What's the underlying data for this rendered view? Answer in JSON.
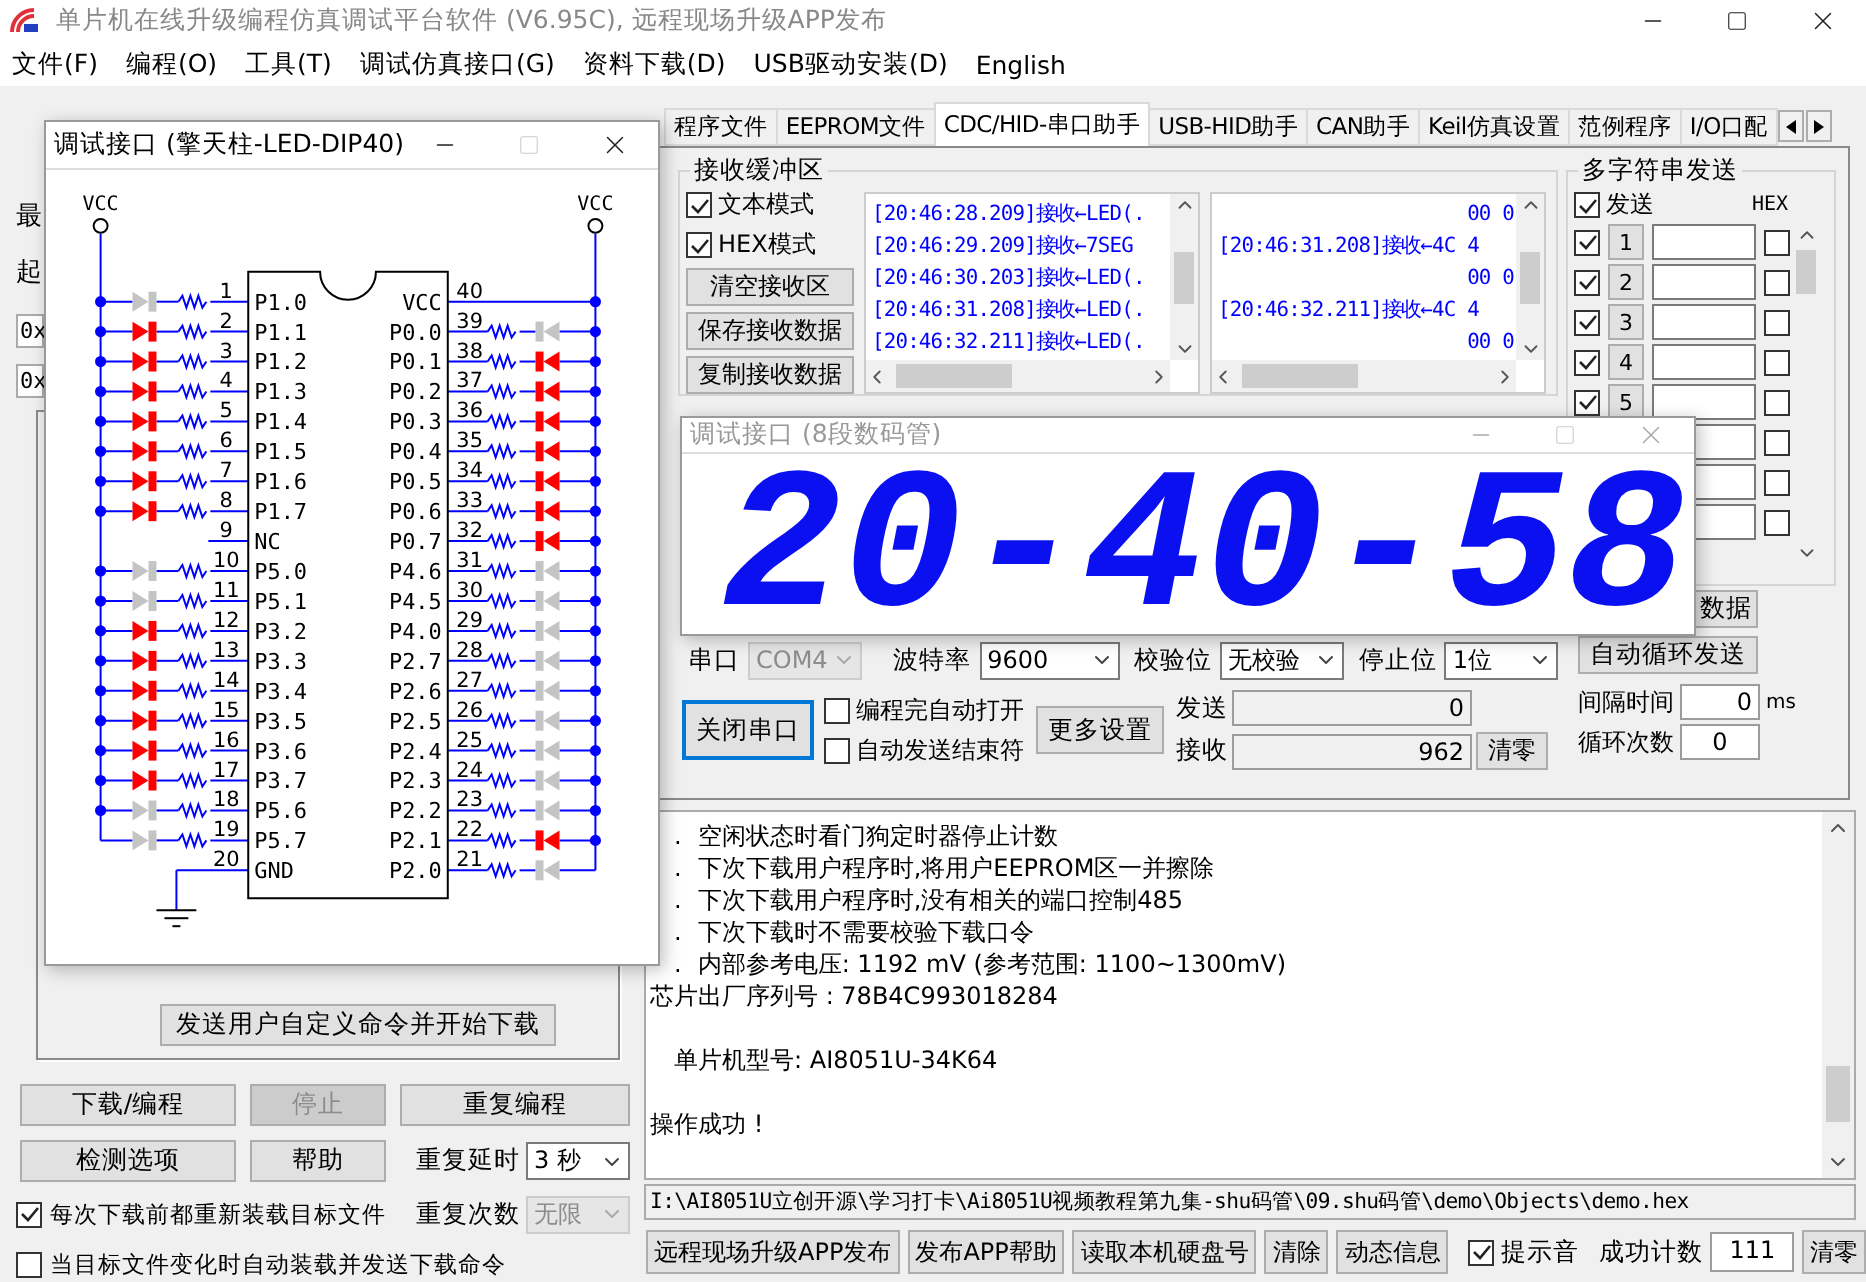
{
  "window": {
    "title": "单片机在线升级编程仿真调试平台软件 (V6.95C), 远程现场升级APP发布"
  },
  "menu": [
    "文件(F)",
    "编程(O)",
    "工具(T)",
    "调试仿真接口(G)",
    "资料下载(D)",
    "USB驱动安装(D)",
    "English"
  ],
  "left_panel": {
    "fragments": [
      {
        "kind": "label",
        "text": "最"
      },
      {
        "kind": "label",
        "text": "起"
      },
      {
        "kind": "field",
        "text": "0x"
      },
      {
        "kind": "field",
        "text": "0x"
      }
    ],
    "custom_command_button": "发送用户自定义命令并开始下载",
    "buttons": [
      {
        "label": "下载/编程",
        "disabled": false
      },
      {
        "label": "停止",
        "disabled": true
      },
      {
        "label": "重复编程",
        "disabled": false
      },
      {
        "label": "检测选项",
        "disabled": false
      },
      {
        "label": "帮助",
        "disabled": false
      }
    ],
    "repeat_delay": {
      "label": "重复延时",
      "value": "3 秒"
    },
    "repeat_count": {
      "label": "重复次数",
      "value": "无限"
    },
    "options": [
      {
        "label": "每次下载前都重新装载目标文件",
        "checked": true
      },
      {
        "label": "当目标文件变化时自动装载并发送下载命令",
        "checked": false
      }
    ]
  },
  "tabs": [
    {
      "label": "程序文件",
      "selected": false
    },
    {
      "label": "EEPROM文件",
      "selected": false
    },
    {
      "label": "CDC/HID-串口助手",
      "selected": true
    },
    {
      "label": "USB-HID助手",
      "selected": false
    },
    {
      "label": "CAN助手",
      "selected": false
    },
    {
      "label": "Keil仿真设置",
      "selected": false
    },
    {
      "label": "范例程序",
      "selected": false
    },
    {
      "label": "I/O口配",
      "selected": false
    }
  ],
  "receive": {
    "title": "接收缓冲区",
    "options": [
      {
        "label": "文本模式",
        "checked": true
      },
      {
        "label": "HEX模式",
        "checked": true
      }
    ],
    "buttons": [
      "清空接收区",
      "保存接收数据",
      "复制接收数据"
    ],
    "text_log": [
      "[20:46:28.209]接收←LED(.",
      "[20:46:29.209]接收←7SEG",
      "[20:46:30.203]接收←LED(.",
      "[20:46:31.208]接收←LED(.",
      "[20:46:32.211]接收←LED(."
    ],
    "hex_log": [
      {
        "kind": "data",
        "text": "00 0"
      },
      {
        "kind": "timestamp",
        "text": "[20:46:31.208]接收←4C 4"
      },
      {
        "kind": "data",
        "text": "00 0"
      },
      {
        "kind": "timestamp",
        "text": "[20:46:32.211]接收←4C 4"
      },
      {
        "kind": "data",
        "text": "00 0"
      }
    ]
  },
  "multi_send": {
    "title": "多字符串发送",
    "send_all": {
      "label": "发送",
      "checked": true
    },
    "hex_header": "HEX",
    "rows": [
      {
        "number": "1",
        "checked": true,
        "hex": false
      },
      {
        "number": "2",
        "checked": true,
        "hex": false
      },
      {
        "number": "3",
        "checked": true,
        "hex": false
      },
      {
        "number": "4",
        "checked": true,
        "hex": false
      },
      {
        "number": "5",
        "checked": true,
        "hex": false
      },
      {
        "hex": false
      },
      {
        "hex": false
      },
      {
        "hex": false
      }
    ],
    "partial_button": "数据",
    "loop_button": "自动循环发送",
    "interval": {
      "label": "间隔时间",
      "value": "0",
      "unit": "ms"
    },
    "loop_count": {
      "label": "循环次数",
      "value": "0"
    }
  },
  "serial": {
    "port": {
      "label": "串口",
      "value": "COM4",
      "disabled": true
    },
    "baud": {
      "label": "波特率",
      "value": "9600"
    },
    "parity": {
      "label": "校验位",
      "value": "无校验"
    },
    "stop_bits": {
      "label": "停止位",
      "value": "1位"
    },
    "close_button": "关闭串口",
    "options": [
      {
        "label": "编程完自动打开",
        "checked": false
      },
      {
        "label": "自动发送结束符",
        "checked": false
      }
    ],
    "more_button": "更多设置",
    "sent": {
      "label": "发送",
      "value": "0"
    },
    "received": {
      "label": "接收",
      "value": "962"
    },
    "clear_button": "清零"
  },
  "log": [
    {
      "kind": "bullet",
      "bullet": ".",
      "text": "空闲状态时看门狗定时器停止计数"
    },
    {
      "kind": "bullet",
      "bullet": ".",
      "text": "下次下载用户程序时,将用户EEPROM区一并擦除"
    },
    {
      "kind": "bullet",
      "bullet": ".",
      "text": "下次下载用户程序时,没有相关的端口控制485"
    },
    {
      "kind": "bullet",
      "bullet": ".",
      "text": "下次下载时不需要校验下载口令"
    },
    {
      "kind": "bullet",
      "bullet": ".",
      "text": "内部参考电压: 1192 mV (参考范围: 1100~1300mV)"
    },
    {
      "kind": "plain",
      "text": "芯片出厂序列号 : 78B4C993018284"
    },
    {
      "kind": "blank"
    },
    {
      "kind": "indented",
      "text": "单片机型号: AI8051U-34K64"
    },
    {
      "kind": "blank"
    },
    {
      "kind": "plain",
      "text": "操作成功 !"
    }
  ],
  "path": "I:\\AI8051U立创开源\\学习打卡\\Ai8051U视频教程第九集-shu码管\\09.shu码管\\demo\\Objects\\demo.hex",
  "bottom_bar": {
    "buttons": [
      "远程现场升级APP发布",
      "发布APP帮助",
      "读取本机硬盘号",
      "清除",
      "动态信息"
    ],
    "sound": {
      "label": "提示音",
      "checked": true
    },
    "success_count": {
      "label": "成功计数",
      "value": "111"
    },
    "clear_button": "清零"
  },
  "dip_window": {
    "title": "调试接口 (擎天柱-LED-DIP40)",
    "vcc_labels": [
      "VCC",
      "VCC"
    ],
    "left_pins": [
      {
        "number": "1",
        "name": "P1.0",
        "kind": "led",
        "lit": false
      },
      {
        "number": "2",
        "name": "P1.1",
        "kind": "led",
        "lit": true
      },
      {
        "number": "3",
        "name": "P1.2",
        "kind": "led",
        "lit": true
      },
      {
        "number": "4",
        "name": "P1.3",
        "kind": "led",
        "lit": true
      },
      {
        "number": "5",
        "name": "P1.4",
        "kind": "led",
        "lit": true
      },
      {
        "number": "6",
        "name": "P1.5",
        "kind": "led",
        "lit": true
      },
      {
        "number": "7",
        "name": "P1.6",
        "kind": "led",
        "lit": true
      },
      {
        "number": "8",
        "name": "P1.7",
        "kind": "led",
        "lit": true
      },
      {
        "number": "9",
        "name": "NC",
        "kind": "nc"
      },
      {
        "number": "10",
        "name": "P5.0",
        "kind": "led",
        "lit": false
      },
      {
        "number": "11",
        "name": "P5.1",
        "kind": "led",
        "lit": false
      },
      {
        "number": "12",
        "name": "P3.2",
        "kind": "led",
        "lit": true
      },
      {
        "number": "13",
        "name": "P3.3",
        "kind": "led",
        "lit": true
      },
      {
        "number": "14",
        "name": "P3.4",
        "kind": "led",
        "lit": true
      },
      {
        "number": "15",
        "name": "P3.5",
        "kind": "led",
        "lit": true
      },
      {
        "number": "16",
        "name": "P3.6",
        "kind": "led",
        "lit": true
      },
      {
        "number": "17",
        "name": "P3.7",
        "kind": "led",
        "lit": true
      },
      {
        "number": "18",
        "name": "P5.6",
        "kind": "led",
        "lit": false
      },
      {
        "number": "19",
        "name": "P5.7",
        "kind": "led",
        "lit": false
      },
      {
        "number": "20",
        "name": "GND",
        "kind": "ground"
      }
    ],
    "right_pins": [
      {
        "number": "40",
        "name": "VCC",
        "kind": "vcc"
      },
      {
        "number": "39",
        "name": "P0.0",
        "kind": "led",
        "lit": false
      },
      {
        "number": "38",
        "name": "P0.1",
        "kind": "led",
        "lit": true
      },
      {
        "number": "37",
        "name": "P0.2",
        "kind": "led",
        "lit": true
      },
      {
        "number": "36",
        "name": "P0.3",
        "kind": "led",
        "lit": true
      },
      {
        "number": "35",
        "name": "P0.4",
        "kind": "led",
        "lit": true
      },
      {
        "number": "34",
        "name": "P0.5",
        "kind": "led",
        "lit": true
      },
      {
        "number": "33",
        "name": "P0.6",
        "kind": "led",
        "lit": true
      },
      {
        "number": "32",
        "name": "P0.7",
        "kind": "led",
        "lit": true
      },
      {
        "number": "31",
        "name": "P4.6",
        "kind": "led",
        "lit": false
      },
      {
        "number": "30",
        "name": "P4.5",
        "kind": "led",
        "lit": false
      },
      {
        "number": "29",
        "name": "P4.0",
        "kind": "led",
        "lit": false
      },
      {
        "number": "28",
        "name": "P2.7",
        "kind": "led",
        "lit": false
      },
      {
        "number": "27",
        "name": "P2.6",
        "kind": "led",
        "lit": false
      },
      {
        "number": "26",
        "name": "P2.5",
        "kind": "led",
        "lit": false
      },
      {
        "number": "25",
        "name": "P2.4",
        "kind": "led",
        "lit": false
      },
      {
        "number": "24",
        "name": "P2.3",
        "kind": "led",
        "lit": false
      },
      {
        "number": "23",
        "name": "P2.2",
        "kind": "led",
        "lit": false
      },
      {
        "number": "22",
        "name": "P2.1",
        "kind": "led",
        "lit": true
      },
      {
        "number": "21",
        "name": "P2.0",
        "kind": "led",
        "lit": false
      }
    ]
  },
  "segment_window": {
    "title": "调试接口 (8段数码管)",
    "digits": "20-40-58"
  }
}
